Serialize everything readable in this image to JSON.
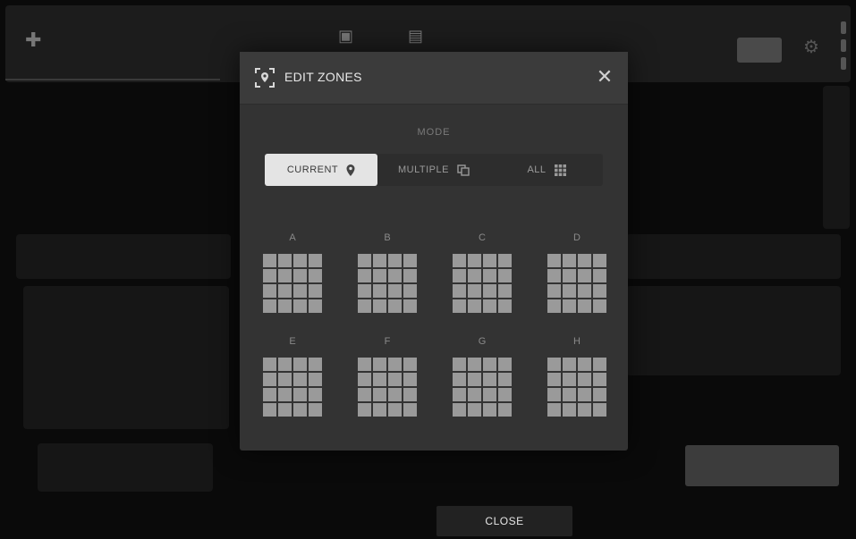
{
  "background": {
    "title": "",
    "right_button": ""
  },
  "modal": {
    "title": "EDIT ZONES",
    "mode_label": "MODE",
    "modes": [
      {
        "label": "CURRENT",
        "icon": "location-pin-icon",
        "active": true
      },
      {
        "label": "MULTIPLE",
        "icon": "multiple-copies-icon",
        "active": false
      },
      {
        "label": "ALL",
        "icon": "grid-icon",
        "active": false
      }
    ],
    "banks": [
      "A",
      "B",
      "C",
      "D",
      "E",
      "F",
      "G",
      "H"
    ]
  },
  "footer": {
    "close_label": "CLOSE"
  },
  "colors": {
    "modal_bg": "#333333",
    "active_mode": "#e4e4e4",
    "pad": "#9a9a9a"
  }
}
